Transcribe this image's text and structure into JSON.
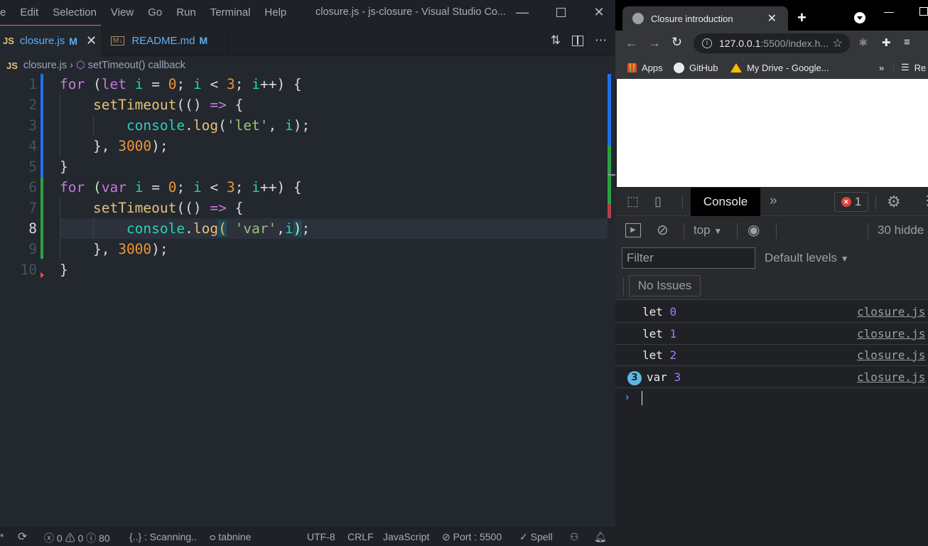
{
  "vscode": {
    "menu": [
      "e",
      "Edit",
      "Selection",
      "View",
      "Go",
      "Run",
      "Terminal",
      "Help"
    ],
    "window_title": "closure.js - js-closure - Visual Studio Co...",
    "tabs": [
      {
        "icon": "JS",
        "name": "closure.js",
        "status": "M",
        "active": true
      },
      {
        "icon": "M↓",
        "name": "README.md",
        "status": "M",
        "active": false
      }
    ],
    "breadcrumb": {
      "file": "closure.js",
      "symbol": "setTimeout() callback"
    },
    "line_numbers": [
      "1",
      "2",
      "3",
      "4",
      "5",
      "6",
      "7",
      "8",
      "9",
      "10"
    ],
    "current_line": "8",
    "code_lines": [
      "for (let i = 0; i < 3; i++) {",
      "    setTimeout(() => {",
      "        console.log('let', i);",
      "    }, 3000);",
      "}",
      "for (var i = 0; i < 3; i++) {",
      "    setTimeout(() => {",
      "        console.log( 'var',i);",
      "    }, 3000);",
      "}"
    ],
    "status": {
      "errors": "0",
      "warnings": "0",
      "info": "80",
      "scanning": "{..} : Scanning..",
      "tabnine": "tabnine",
      "encoding": "UTF-8",
      "eol": "CRLF",
      "language": "JavaScript",
      "port": "Port : 5500",
      "spell": "Spell"
    },
    "colors": {
      "git_added": "#2ea043",
      "git_modified": "#1f6feb",
      "git_deleted": "#f14c4c"
    }
  },
  "browser": {
    "tab_title": "Closure introduction",
    "url_host": "127.0.0.1",
    "url_rest": ":5500/index.h...",
    "bookmarks": [
      "Apps",
      "GitHub",
      "My Drive - Google..."
    ],
    "bookmarks_overflow": "»",
    "reading_list": "Re",
    "devtools": {
      "active_tab": "Console",
      "error_count": "1",
      "context": "top",
      "hidden": "30 hidde",
      "filter_placeholder": "Filter",
      "levels": "Default levels",
      "issues": "No Issues",
      "messages": [
        {
          "text": "let",
          "value": "0",
          "source": "closure.js",
          "repeat": ""
        },
        {
          "text": "let",
          "value": "1",
          "source": "closure.js",
          "repeat": ""
        },
        {
          "text": "let",
          "value": "2",
          "source": "closure.js",
          "repeat": ""
        },
        {
          "text": "var",
          "value": "3",
          "source": "closure.js",
          "repeat": "3"
        }
      ]
    }
  }
}
